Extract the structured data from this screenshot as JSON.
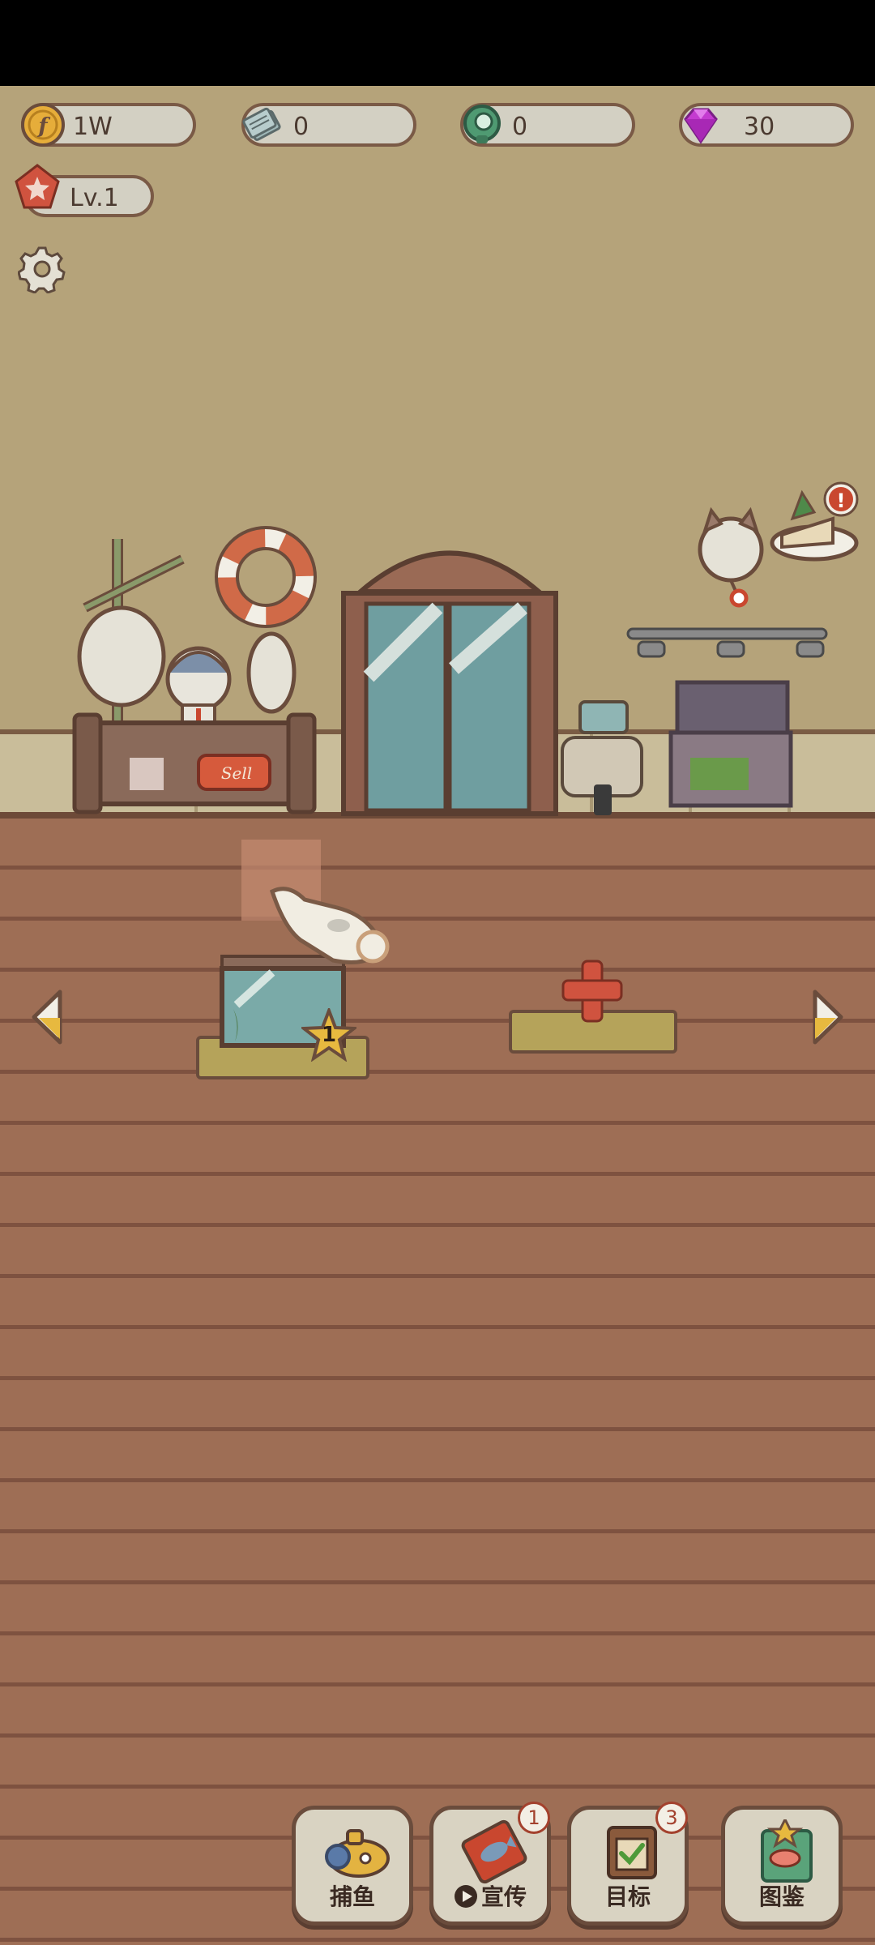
{
  "resources": {
    "coins": {
      "icon": "coin-icon",
      "value": "1W",
      "color": "#e0a530"
    },
    "fish_tickets": {
      "icon": "ticket-stack-icon",
      "value": "0",
      "color": "#7fa3a8"
    },
    "shells": {
      "icon": "green-shell-icon",
      "value": "0",
      "color": "#4f9a72"
    },
    "gems": {
      "icon": "gem-icon",
      "value": "30",
      "color": "#b52fc2"
    }
  },
  "level": {
    "icon": "level-star-icon",
    "label": "Lv.1"
  },
  "settings": {
    "icon": "gear-icon"
  },
  "shop": {
    "counter_sign": "Sell",
    "tank_level": "1",
    "add_slot_icon": "plus-icon",
    "alert_mark": "!"
  },
  "bottom_nav": [
    {
      "name": "fishing",
      "icon": "submarine-icon",
      "label": "捕鱼",
      "badge": ""
    },
    {
      "name": "promote",
      "icon": "fish-poster-icon",
      "label": "宣传",
      "badge": "1",
      "has_video_icon": true
    },
    {
      "name": "goals",
      "icon": "checklist-icon",
      "label": "目标",
      "badge": "3"
    },
    {
      "name": "album",
      "icon": "fish-album-icon",
      "label": "图鉴",
      "badge": ""
    }
  ],
  "colors": {
    "wall": "#b5a37a",
    "floor": "#9e6e55",
    "accent_red": "#c9472f",
    "outline": "#6a4c3c"
  }
}
